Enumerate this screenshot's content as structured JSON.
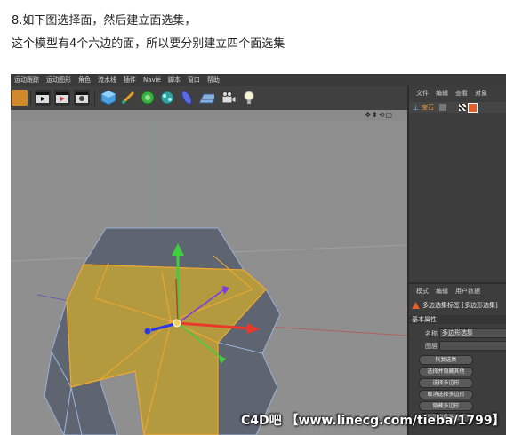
{
  "captions": {
    "line1": "8.如下图选择面，然后建立面选集，",
    "line2": "这个模型有4个六边的面，所以要分别建立四个面选集"
  },
  "menu": [
    "运动跟踪",
    "运动图形",
    "角色",
    "流水线",
    "插件",
    "Navié",
    "脚本",
    "窗口",
    "帮助"
  ],
  "object_manager": {
    "tabs": [
      "文件",
      "编辑",
      "查看",
      "对象"
    ],
    "object_name": "宝石"
  },
  "attribute_manager": {
    "tabs": [
      "模式",
      "编辑",
      "用户数据"
    ],
    "title": "多边选集标签 [多边形选集]",
    "section": "基本属性",
    "name_label": "名称",
    "name_value": "多边形选集",
    "layer_label": "图层",
    "layer_value": "",
    "buttons": [
      "恢复选集",
      "选择并隐藏其他",
      "选择多边形",
      "取消选择多边形",
      "隐藏多边形",
      "取消隐藏多边形"
    ]
  },
  "watermark": "C4D吧 【www.linecg.com/tieba/1799】",
  "colors": {
    "viewport_bg": "#8f8f8f",
    "selected_face": "#b39a3f",
    "selected_edge": "#f0a830",
    "unselected_face": "#5e6470",
    "unselected_edge": "#9ab0d8",
    "axis_y": "#3ecf3e",
    "axis_x": "#e83a2a",
    "axis_z": "#2a3ae8"
  }
}
